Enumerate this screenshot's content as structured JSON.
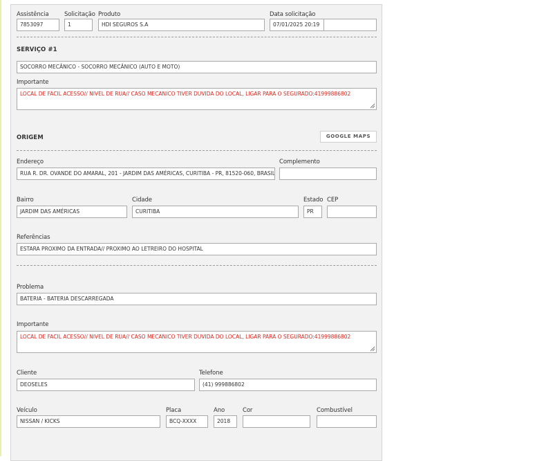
{
  "header": {
    "assistencia_label": "Assistência",
    "assistencia_value": "7853097",
    "solicitacao_label": "Solicitação",
    "solicitacao_value": "1",
    "produto_label": "Produto",
    "produto_value": "HDI SEGUROS S.A",
    "data_label": "Data solicitação",
    "data_value": "07/01/2025 20:19",
    "data_extra_value": ""
  },
  "servico": {
    "title": "SERVIÇO #1",
    "value": "SOCORRO MECÂNICO - SOCORRO MECÂNICO (AUTO E MOTO)",
    "importante_label": "Importante",
    "importante_value": "LOCAL DE FACIL ACESSO// NIVEL DE RUA// CASO MECANICO TIVER DUVIDA DO LOCAL, LIGAR PARA O SEGURADO:41999886802"
  },
  "origem": {
    "title": "ORIGEM",
    "maps_button": "GOOGLE MAPS",
    "endereco_label": "Endereço",
    "endereco_value": "RUA R. DR. OVANDE DO AMARAL, 201 - JARDIM DAS AMÉRICAS, CURITIBA - PR, 81520-060, BRASIL, :",
    "complemento_label": "Complemento",
    "complemento_value": "",
    "bairro_label": "Bairro",
    "bairro_value": "JARDIM DAS AMÉRICAS",
    "cidade_label": "Cidade",
    "cidade_value": "CURITIBA",
    "estado_label": "Estado",
    "estado_value": "PR",
    "cep_label": "CEP",
    "cep_value": "",
    "referencias_label": "Referências",
    "referencias_value": "ESTARA PROXIMO DA ENTRADA// PROXIMO AO LETREIRO DO HOSPITAL"
  },
  "problema": {
    "problema_label": "Problema",
    "problema_value": "BATERIA - BATERIA DESCARREGADA",
    "importante_label": "Importante",
    "importante_value": "LOCAL DE FACIL ACESSO// NIVEL DE RUA// CASO MECANICO TIVER DUVIDA DO LOCAL, LIGAR PARA O SEGURADO:41999886802"
  },
  "cliente": {
    "cliente_label": "Cliente",
    "cliente_value": "DEOSELES",
    "telefone_label": "Telefone",
    "telefone_value": "(41) 999886802"
  },
  "veiculo": {
    "veiculo_label": "Veículo",
    "veiculo_value": "NISSAN / KICKS",
    "placa_label": "Placa",
    "placa_value": "BCQ-XXXX",
    "ano_label": "Ano",
    "ano_value": "2018",
    "cor_label": "Cor",
    "cor_value": "",
    "combustivel_label": "Combustível",
    "combustivel_value": ""
  },
  "colors": {
    "panel_bg": "#f2f2f2",
    "warning_text": "#d9261c",
    "accent_left_bar": "#e7efb0"
  },
  "icons": {
    "resize": "resize-grip-icon"
  }
}
